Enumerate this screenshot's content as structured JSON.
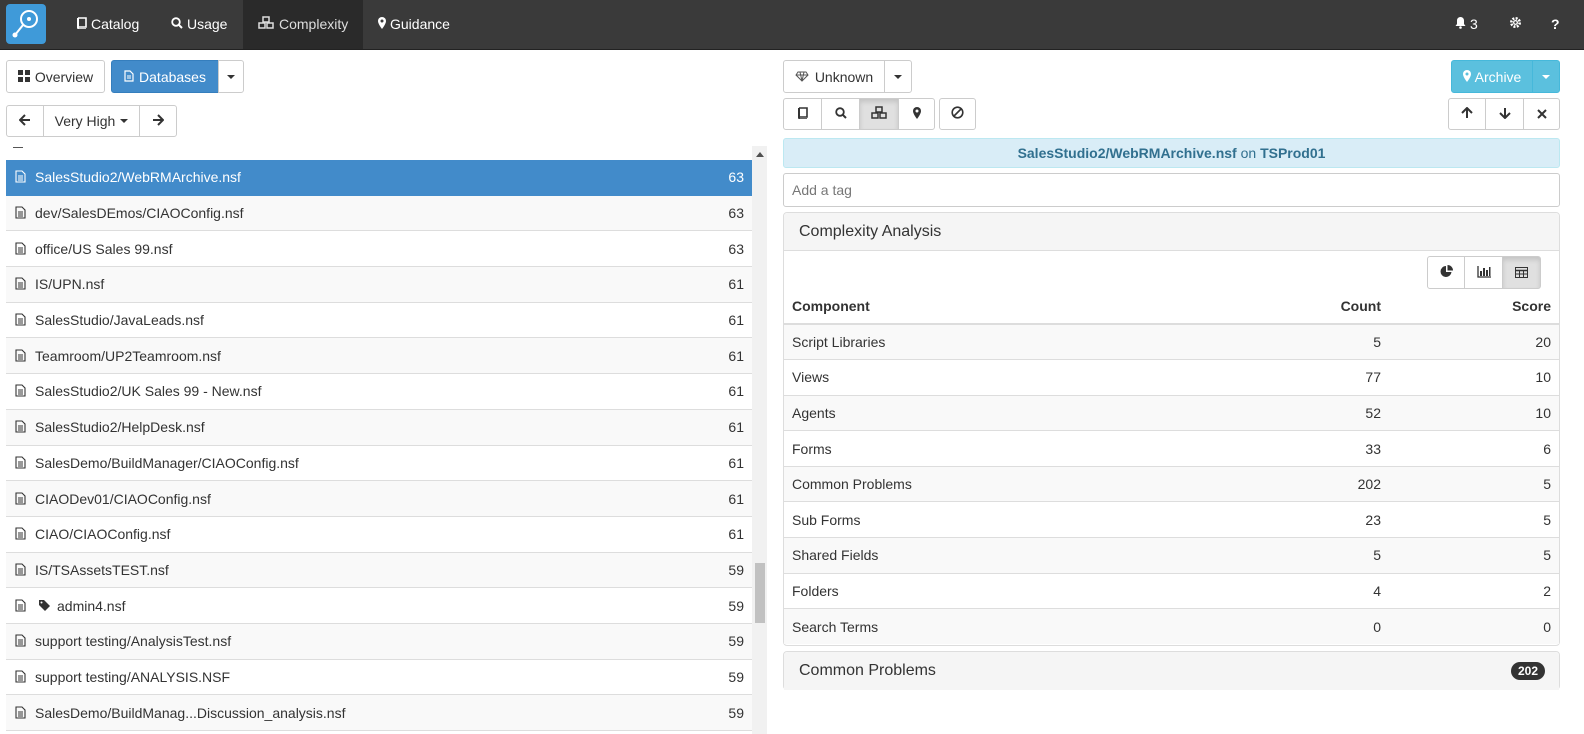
{
  "nav": {
    "items": [
      {
        "label": "Catalog",
        "icon": "book-icon"
      },
      {
        "label": "Usage",
        "icon": "search-icon"
      },
      {
        "label": "Complexity",
        "icon": "cubes-icon"
      },
      {
        "label": "Guidance",
        "icon": "map-marker-icon"
      }
    ],
    "notifications_count": "3",
    "help_label": "?"
  },
  "left": {
    "overview_label": "Overview",
    "databases_label": "Databases",
    "level_label": "Very High",
    "rows": [
      {
        "name": "SalesStudio2/WebRMArchive.nsf",
        "score": "63"
      },
      {
        "name": "dev/SalesDEmos/CIAOConfig.nsf",
        "score": "63"
      },
      {
        "name": "office/US Sales 99.nsf",
        "score": "63"
      },
      {
        "name": "IS/UPN.nsf",
        "score": "61"
      },
      {
        "name": "SalesStudio/JavaLeads.nsf",
        "score": "61"
      },
      {
        "name": "Teamroom/UP2Teamroom.nsf",
        "score": "61"
      },
      {
        "name": "SalesStudio2/UK Sales 99 - New.nsf",
        "score": "61"
      },
      {
        "name": "SalesStudio2/HelpDesk.nsf",
        "score": "61"
      },
      {
        "name": "SalesDemo/BuildManager/CIAOConfig.nsf",
        "score": "61"
      },
      {
        "name": "CIAODev01/CIAOConfig.nsf",
        "score": "61"
      },
      {
        "name": "CIAO/CIAOConfig.nsf",
        "score": "61"
      },
      {
        "name": "IS/TSAssetsTEST.nsf",
        "score": "59"
      },
      {
        "name": "admin4.nsf",
        "score": "59",
        "tagged": true
      },
      {
        "name": "support testing/AnalysisTest.nsf",
        "score": "59"
      },
      {
        "name": "support testing/ANALYSIS.NSF",
        "score": "59"
      },
      {
        "name": "SalesDemo/BuildManag...Discussion_analysis.nsf",
        "score": "59"
      }
    ]
  },
  "right": {
    "unknown_label": "Unknown",
    "archive_label": "Archive",
    "info": {
      "db": "SalesStudio2/WebRMArchive.nsf",
      "on": "on",
      "server": "TSProd01"
    },
    "tag_placeholder": "Add a tag",
    "complexity": {
      "title": "Complexity Analysis",
      "headers": {
        "component": "Component",
        "count": "Count",
        "score": "Score"
      },
      "rows": [
        {
          "component": "Script Libraries",
          "count": "5",
          "score": "20"
        },
        {
          "component": "Views",
          "count": "77",
          "score": "10"
        },
        {
          "component": "Agents",
          "count": "52",
          "score": "10"
        },
        {
          "component": "Forms",
          "count": "33",
          "score": "6"
        },
        {
          "component": "Common Problems",
          "count": "202",
          "score": "5"
        },
        {
          "component": "Sub Forms",
          "count": "23",
          "score": "5"
        },
        {
          "component": "Shared Fields",
          "count": "5",
          "score": "5"
        },
        {
          "component": "Folders",
          "count": "4",
          "score": "2"
        },
        {
          "component": "Search Terms",
          "count": "0",
          "score": "0"
        }
      ]
    },
    "problems": {
      "title": "Common Problems",
      "badge": "202"
    }
  },
  "colors": {
    "primary": "#428bca",
    "info": "#5bc0de",
    "navbar": "#3a3a3a"
  }
}
